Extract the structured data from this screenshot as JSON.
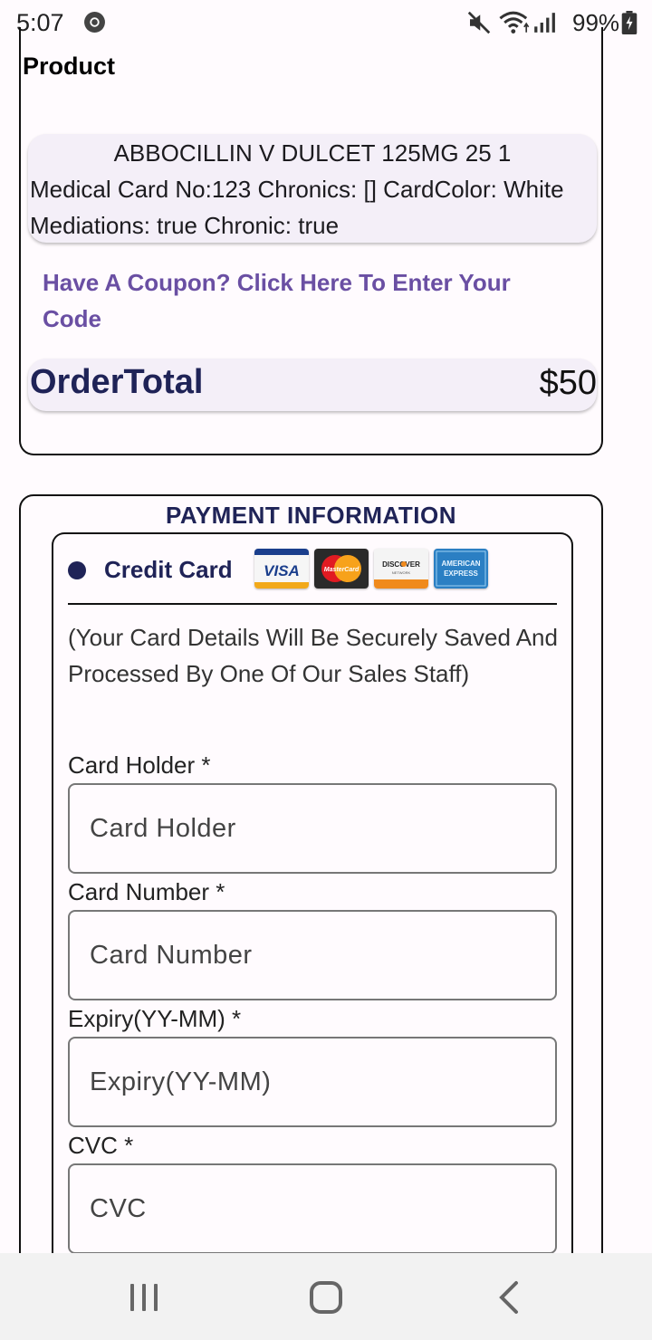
{
  "status_bar": {
    "time": "5:07",
    "battery": "99%"
  },
  "product_section": {
    "title": "Product",
    "item_name": "ABBOCILLIN V DULCET 125MG 25 1",
    "item_details": "Medical Card No:123 Chronics: [] CardColor: White Mediations: true Chronic: true",
    "coupon_link": "Have A Coupon? Click Here To Enter Your Code",
    "order_total_label": "OrderTotal",
    "order_total_value": "$50"
  },
  "payment_section": {
    "title": "PAYMENT INFORMATION",
    "method_label": "Credit Card",
    "card_logos": [
      "visa-logo",
      "mastercard-logo",
      "discover-logo",
      "american-express-logo"
    ],
    "secure_note": "(Your Card Details Will Be Securely Saved And Processed By One Of Our Sales Staff)",
    "fields": {
      "card_holder": {
        "label": "Card Holder *",
        "placeholder": "Card Holder",
        "value": ""
      },
      "card_number": {
        "label": "Card Number *",
        "placeholder": "Card Number",
        "value": ""
      },
      "expiry": {
        "label": "Expiry(YY-MM) *",
        "placeholder": "Expiry(YY-MM)",
        "value": ""
      },
      "cvc": {
        "label": "CVC *",
        "placeholder": "CVC",
        "value": ""
      }
    }
  },
  "colors": {
    "accent": "#1f2357",
    "link": "#6a4fa3",
    "card_bg": "#f4eff8",
    "page_bg": "#fffbfe"
  }
}
